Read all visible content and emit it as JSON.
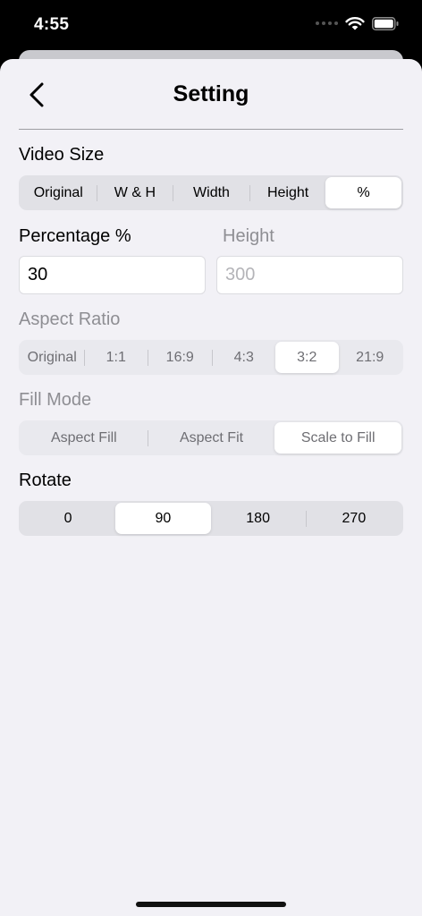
{
  "status": {
    "time": "4:55"
  },
  "nav": {
    "title": "Setting"
  },
  "video_size": {
    "label": "Video Size",
    "options": [
      "Original",
      "W & H",
      "Width",
      "Height",
      "%"
    ],
    "selected": 4
  },
  "percentage": {
    "label": "Percentage %",
    "value": "30"
  },
  "height": {
    "label": "Height",
    "placeholder": "300"
  },
  "aspect_ratio": {
    "label": "Aspect Ratio",
    "options": [
      "Original",
      "1:1",
      "16:9",
      "4:3",
      "3:2",
      "21:9"
    ],
    "selected": 4
  },
  "fill_mode": {
    "label": "Fill Mode",
    "options": [
      "Aspect Fill",
      "Aspect Fit",
      "Scale to Fill"
    ],
    "selected": 2
  },
  "rotate": {
    "label": "Rotate",
    "options": [
      "0",
      "90",
      "180",
      "270"
    ],
    "selected": 1
  }
}
